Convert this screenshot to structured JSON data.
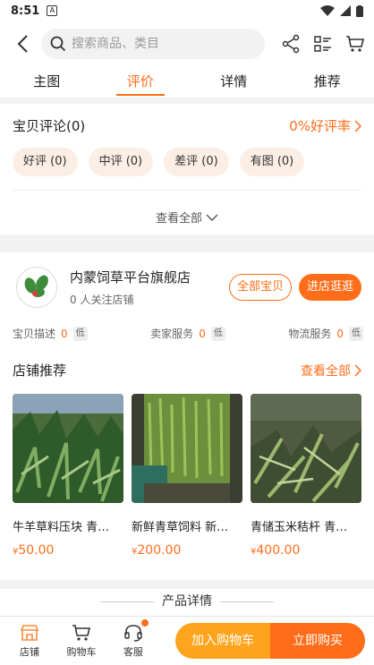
{
  "status": {
    "time": "8:51"
  },
  "search": {
    "placeholder": "搜索商品、类目"
  },
  "tabs": [
    {
      "label": "主图"
    },
    {
      "label": "评价"
    },
    {
      "label": "详情"
    },
    {
      "label": "推荐"
    }
  ],
  "reviews": {
    "title": "宝贝评论(0)",
    "rate": "0%好评率",
    "chips": [
      "好评 (0)",
      "中评 (0)",
      "差评 (0)",
      "有图 (0)"
    ],
    "view_all": "查看全部"
  },
  "shop": {
    "name": "内蒙饲草平台旗舰店",
    "followers": "0 人关注店铺",
    "all_items_button": "全部宝贝",
    "visit_button": "进店逛逛",
    "scores": [
      {
        "label": "宝贝描述",
        "value": "0",
        "level": "低"
      },
      {
        "label": "卖家服务",
        "value": "0",
        "level": "低"
      },
      {
        "label": "物流服务",
        "value": "0",
        "level": "低"
      }
    ]
  },
  "recommend": {
    "title": "店铺推荐",
    "more": "查看全部",
    "products": [
      {
        "title": "牛羊草料压块 青…",
        "currency": "¥",
        "price": "50.00"
      },
      {
        "title": "新鲜青草饲料 新…",
        "currency": "¥",
        "price": "200.00"
      },
      {
        "title": "青储玉米秸杆 青…",
        "currency": "¥",
        "price": "400.00"
      }
    ]
  },
  "detail": {
    "title": "产品详情"
  },
  "bottom": {
    "store": "店铺",
    "cart": "购物车",
    "service": "客服",
    "add_to_cart": "加入购物车",
    "buy_now": "立即购买"
  },
  "colors": {
    "accent": "#ff6d1a",
    "secondary": "#ffa51d"
  }
}
